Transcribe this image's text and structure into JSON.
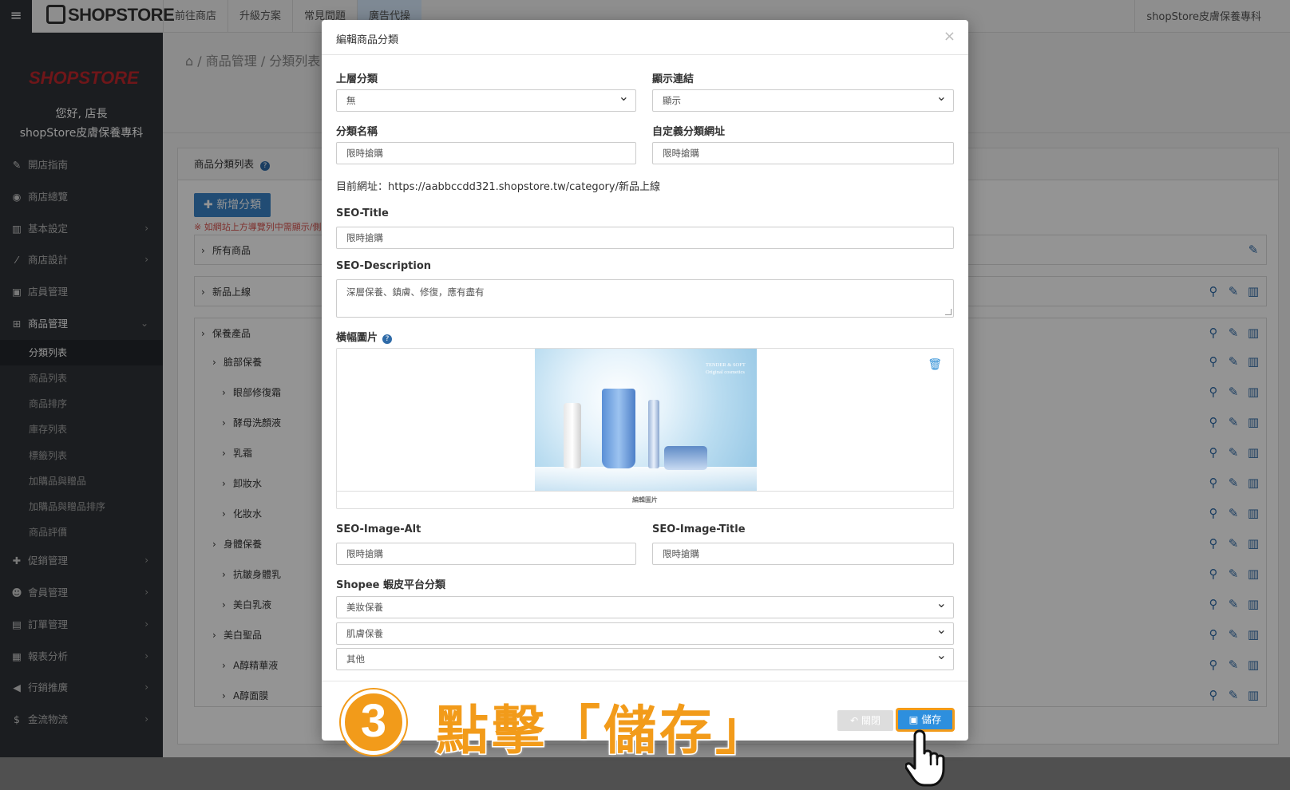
{
  "topbar": {
    "brand": "SHOPSTORE",
    "nav": [
      "前往商店",
      "升級方案",
      "常見問題",
      "廣告代操"
    ],
    "shop_name": "shopStore皮膚保養專科"
  },
  "sidebar": {
    "logo": "SHOPSTORE",
    "greeting": "您好, 店長",
    "store": "shopStore皮膚保養專科",
    "menu": [
      {
        "icon": "wrench-icon",
        "label": "開店指南"
      },
      {
        "icon": "dashboard-icon",
        "label": "商店總覽"
      },
      {
        "icon": "bank-icon",
        "label": "基本設定"
      },
      {
        "icon": "magic-icon",
        "label": "商店設計"
      },
      {
        "icon": "lock-icon",
        "label": "店員管理"
      },
      {
        "icon": "cart-icon",
        "label": "商品管理"
      }
    ],
    "submenu": [
      "分類列表",
      "商品列表",
      "商品排序",
      "庫存列表",
      "標籤列表",
      "加購品與贈品",
      "加購品與贈品排序",
      "商品評價"
    ],
    "menu2": [
      {
        "icon": "gift-icon",
        "label": "促銷管理"
      },
      {
        "icon": "users-icon",
        "label": "會員管理"
      },
      {
        "icon": "order-icon",
        "label": "訂單管理"
      },
      {
        "icon": "chart-icon",
        "label": "報表分析"
      },
      {
        "icon": "megaphone-icon",
        "label": "行銷推廣"
      },
      {
        "icon": "dollar-icon",
        "label": "金流物流"
      }
    ]
  },
  "content": {
    "breadcrumb": "/ 商品管理 / 分類列表",
    "panel_title": "商品分類列表",
    "add_button": "新增分類",
    "note": "※ 如網站上方導覽列中需顯示/側",
    "categories": {
      "all": "所有商品",
      "new": "新品上線",
      "care": "保養產品",
      "tree": [
        "臉部保養",
        "眼部修復霜",
        "酵母洗顏液",
        "乳霜",
        "卸妝水",
        "化妝水",
        "身體保養",
        "抗皺身體乳",
        "美白乳液",
        "美白聖品",
        "A醇精華液",
        "A醇面膜"
      ]
    }
  },
  "modal": {
    "title": "編輯商品分類",
    "parent_label": "上層分類",
    "parent_value": "無",
    "show_link_label": "顯示連結",
    "show_link_value": "顯示",
    "name_label": "分類名稱",
    "name_value": "限時搶購",
    "custom_url_label": "自定義分類網址",
    "custom_url_value": "限時搶購",
    "current_url": "目前網址：https://aabbccdd321.shopstore.tw/category/新品上線",
    "seo_title_label": "SEO-Title",
    "seo_title_value": "限時搶購",
    "seo_desc_label": "SEO-Description",
    "seo_desc_value": "深層保養、鎮膚、修復，應有盡有",
    "banner_label": "橫幅圖片",
    "banner_caption": "編輯圖片",
    "banner_text": "TENDER & SOFT",
    "banner_subtext": "Original cosmetics",
    "seo_alt_label": "SEO-Image-Alt",
    "seo_alt_value": "限時搶購",
    "seo_img_title_label": "SEO-Image-Title",
    "seo_img_title_value": "限時搶購",
    "shopee_label": "Shopee 蝦皮平台分類",
    "shopee_1": "美妝保養",
    "shopee_2": "肌膚保養",
    "shopee_3": "其他",
    "close_label": "關閉",
    "save_label": "儲存"
  },
  "annotation": {
    "step": "3",
    "text": "點擊「儲存」"
  },
  "colors": {
    "accent": "#f29b1a",
    "primary": "#2d8fde",
    "sidebar": "#2f3338"
  }
}
